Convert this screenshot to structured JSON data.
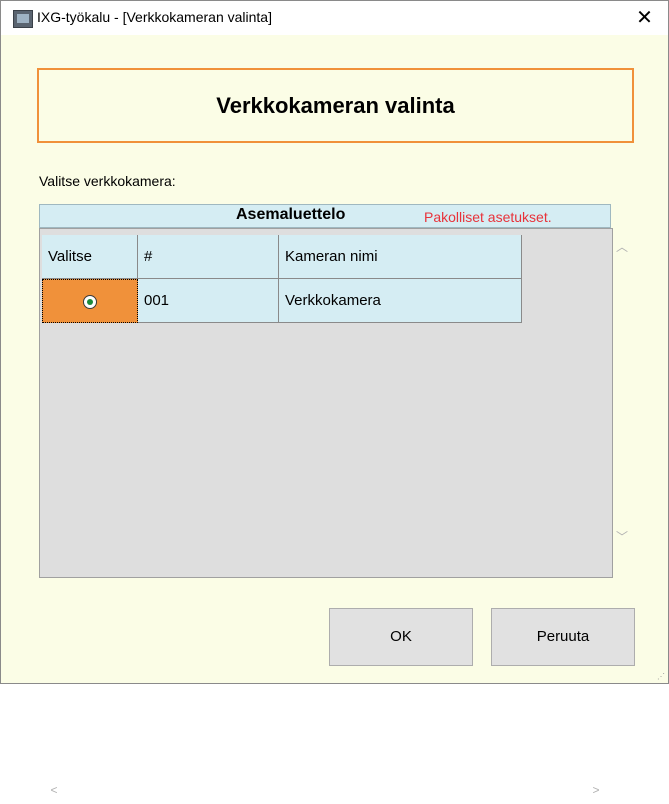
{
  "window": {
    "title": "IXG-työkalu - [Verkkokameran valinta]",
    "icon": "app-camera-icon",
    "close_glyph": "✕"
  },
  "header": {
    "title": "Verkkokameran valinta"
  },
  "select_label": "Valitse verkkokamera:",
  "list": {
    "title": "Asemaluettelo",
    "required_note": "Pakolliset asetukset.",
    "columns": [
      "Valitse",
      "#",
      "Kameran nimi"
    ],
    "rows": [
      {
        "selected": true,
        "number": "001",
        "name": "Verkkokamera"
      }
    ]
  },
  "buttons": {
    "ok": "OK",
    "cancel": "Peruuta"
  },
  "colors": {
    "window_bg": "#fbfde6",
    "accent_orange": "#f0913a",
    "list_header_bg": "#d5edf3",
    "required_red": "#e8323a",
    "grid_bg": "#dedede"
  }
}
